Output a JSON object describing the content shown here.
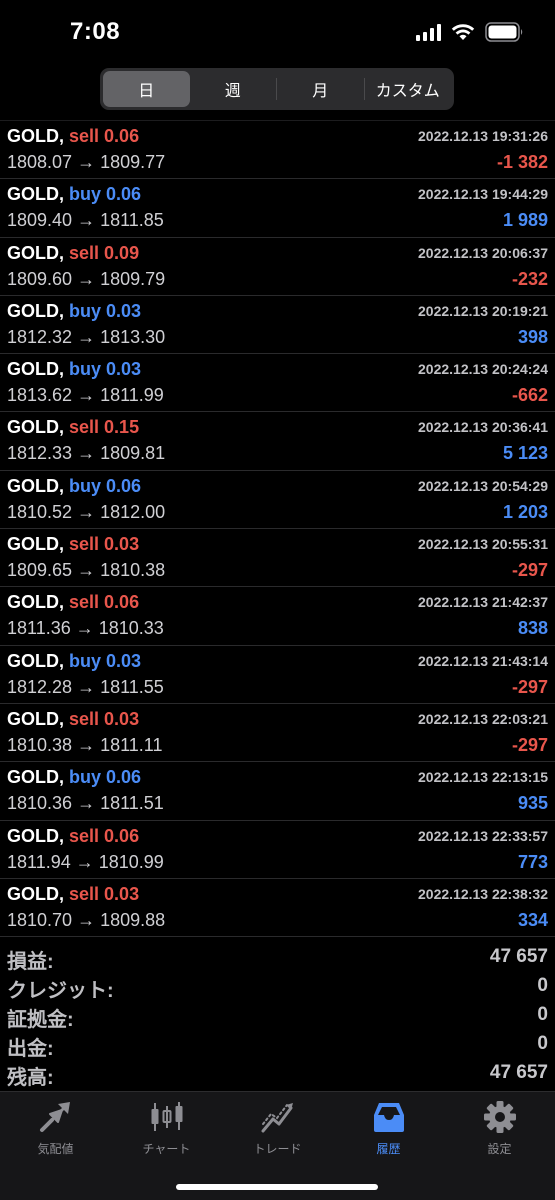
{
  "status": {
    "time": "7:08"
  },
  "segments": [
    {
      "label": "日",
      "active": true
    },
    {
      "label": "週",
      "active": false
    },
    {
      "label": "月",
      "active": false
    },
    {
      "label": "カスタム",
      "active": false
    }
  ],
  "trades": [
    {
      "symbol": "GOLD,",
      "side": "sell 0.06",
      "time": "2022.12.13 19:31:26",
      "prices": "1808.07 → 1809.77",
      "profit": "-1 382",
      "profit_color": "red"
    },
    {
      "symbol": "GOLD,",
      "side": "buy 0.06",
      "time": "2022.12.13 19:44:29",
      "prices": "1809.40 → 1811.85",
      "profit": "1 989",
      "profit_color": "blue"
    },
    {
      "symbol": "GOLD,",
      "side": "sell 0.09",
      "time": "2022.12.13 20:06:37",
      "prices": "1809.60 → 1809.79",
      "profit": "-232",
      "profit_color": "red"
    },
    {
      "symbol": "GOLD,",
      "side": "buy 0.03",
      "time": "2022.12.13 20:19:21",
      "prices": "1812.32 → 1813.30",
      "profit": "398",
      "profit_color": "blue"
    },
    {
      "symbol": "GOLD,",
      "side": "buy 0.03",
      "time": "2022.12.13 20:24:24",
      "prices": "1813.62 → 1811.99",
      "profit": "-662",
      "profit_color": "red"
    },
    {
      "symbol": "GOLD,",
      "side": "sell 0.15",
      "time": "2022.12.13 20:36:41",
      "prices": "1812.33 → 1809.81",
      "profit": "5 123",
      "profit_color": "blue"
    },
    {
      "symbol": "GOLD,",
      "side": "buy 0.06",
      "time": "2022.12.13 20:54:29",
      "prices": "1810.52 → 1812.00",
      "profit": "1 203",
      "profit_color": "blue"
    },
    {
      "symbol": "GOLD,",
      "side": "sell 0.03",
      "time": "2022.12.13 20:55:31",
      "prices": "1809.65 → 1810.38",
      "profit": "-297",
      "profit_color": "red"
    },
    {
      "symbol": "GOLD,",
      "side": "sell 0.06",
      "time": "2022.12.13 21:42:37",
      "prices": "1811.36 → 1810.33",
      "profit": "838",
      "profit_color": "blue"
    },
    {
      "symbol": "GOLD,",
      "side": "buy 0.03",
      "time": "2022.12.13 21:43:14",
      "prices": "1812.28 → 1811.55",
      "profit": "-297",
      "profit_color": "red"
    },
    {
      "symbol": "GOLD,",
      "side": "sell 0.03",
      "time": "2022.12.13 22:03:21",
      "prices": "1810.38 → 1811.11",
      "profit": "-297",
      "profit_color": "red"
    },
    {
      "symbol": "GOLD,",
      "side": "buy 0.06",
      "time": "2022.12.13 22:13:15",
      "prices": "1810.36 → 1811.51",
      "profit": "935",
      "profit_color": "blue"
    },
    {
      "symbol": "GOLD,",
      "side": "sell 0.06",
      "time": "2022.12.13 22:33:57",
      "prices": "1811.94 → 1810.99",
      "profit": "773",
      "profit_color": "blue"
    },
    {
      "symbol": "GOLD,",
      "side": "sell 0.03",
      "time": "2022.12.13 22:38:32",
      "prices": "1810.70 → 1809.88",
      "profit": "334",
      "profit_color": "blue"
    }
  ],
  "summary": [
    {
      "label": "損益:",
      "value": "47 657"
    },
    {
      "label": "クレジット:",
      "value": "0"
    },
    {
      "label": "証拠金:",
      "value": "0"
    },
    {
      "label": "出金:",
      "value": "0"
    },
    {
      "label": "残高:",
      "value": "47 657"
    }
  ],
  "tabs": [
    {
      "label": "気配値",
      "icon": "quotes-arrows-icon",
      "active": false
    },
    {
      "label": "チャート",
      "icon": "candlestick-chart-icon",
      "active": false
    },
    {
      "label": "トレード",
      "icon": "trade-line-chart-icon",
      "active": false
    },
    {
      "label": "履歴",
      "icon": "inbox-tray-icon",
      "active": true
    },
    {
      "label": "設定",
      "icon": "gear-icon",
      "active": false
    }
  ],
  "colors": {
    "red": "#e8564c",
    "blue": "#4b8cf6",
    "active_tab": "#4b8cf6",
    "inactive_tab": "#8e8e93"
  }
}
